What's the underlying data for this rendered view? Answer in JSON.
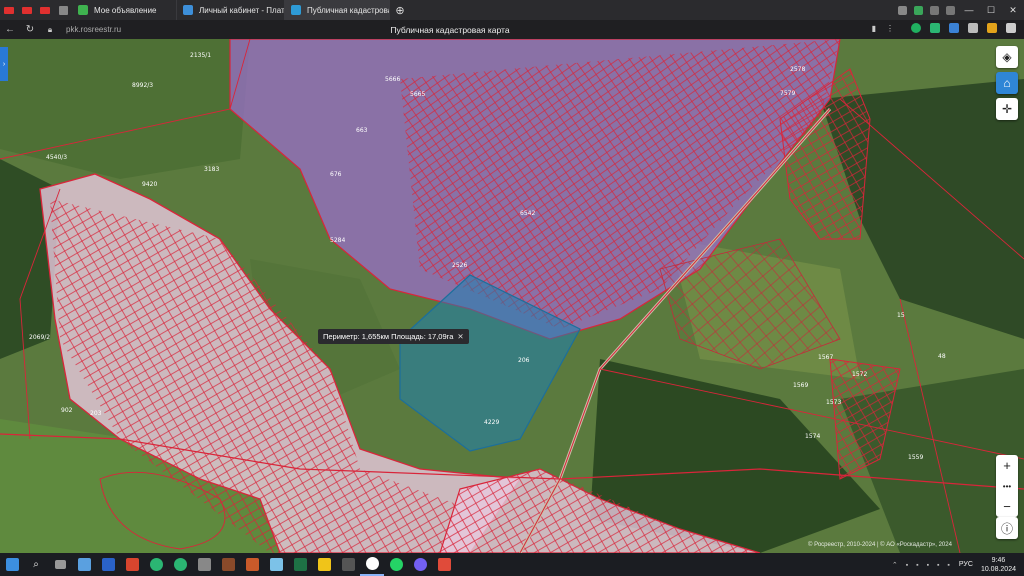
{
  "browser": {
    "tabs": [
      {
        "label": "Мое объявление",
        "active": false,
        "favicon_color": "#3fb34f"
      },
      {
        "label": "Личный кабинет - Платн",
        "active": false,
        "favicon_color": "#3d8fd9"
      },
      {
        "label": "Публичная кадастровая",
        "active": true,
        "favicon_color": "#2e9bd6"
      }
    ],
    "new_tab_icon": "plus-icon",
    "url": "pkk.rosreestr.ru",
    "page_title": "Публичная кадастровая карта"
  },
  "map": {
    "measure_label": "Периметр: 1,655км Площадь: 17,09га",
    "copyright": "© Росреестр, 2010-2024 | © АО «Роскадастр», 2024",
    "parcel_labels": [
      "2135/1",
      "5666",
      "5665",
      "663",
      "676",
      "5284",
      "6542",
      "2526",
      "206",
      "4229",
      "8992/3",
      "9420",
      "4540/3",
      "3183",
      "1567",
      "1569",
      "1572",
      "1573",
      "1574",
      "1559",
      "2069/2",
      "902",
      "203",
      "15",
      "48",
      "2578",
      "7579"
    ],
    "controls": {
      "layers": "layers-icon",
      "home": "home-icon",
      "location": "crosshair-icon",
      "zoom_in": "+",
      "zoom_out": "−",
      "info": "info-icon"
    }
  },
  "taskbar": {
    "language": "РУС",
    "time": "9:46",
    "date": "10.08.2024"
  },
  "colors": {
    "parcel_stroke": "#d9253a",
    "selected_fill": "#1e7fb0",
    "quarter_fill": "#9a6fc9",
    "settlement_fill": "#e9c9de"
  }
}
